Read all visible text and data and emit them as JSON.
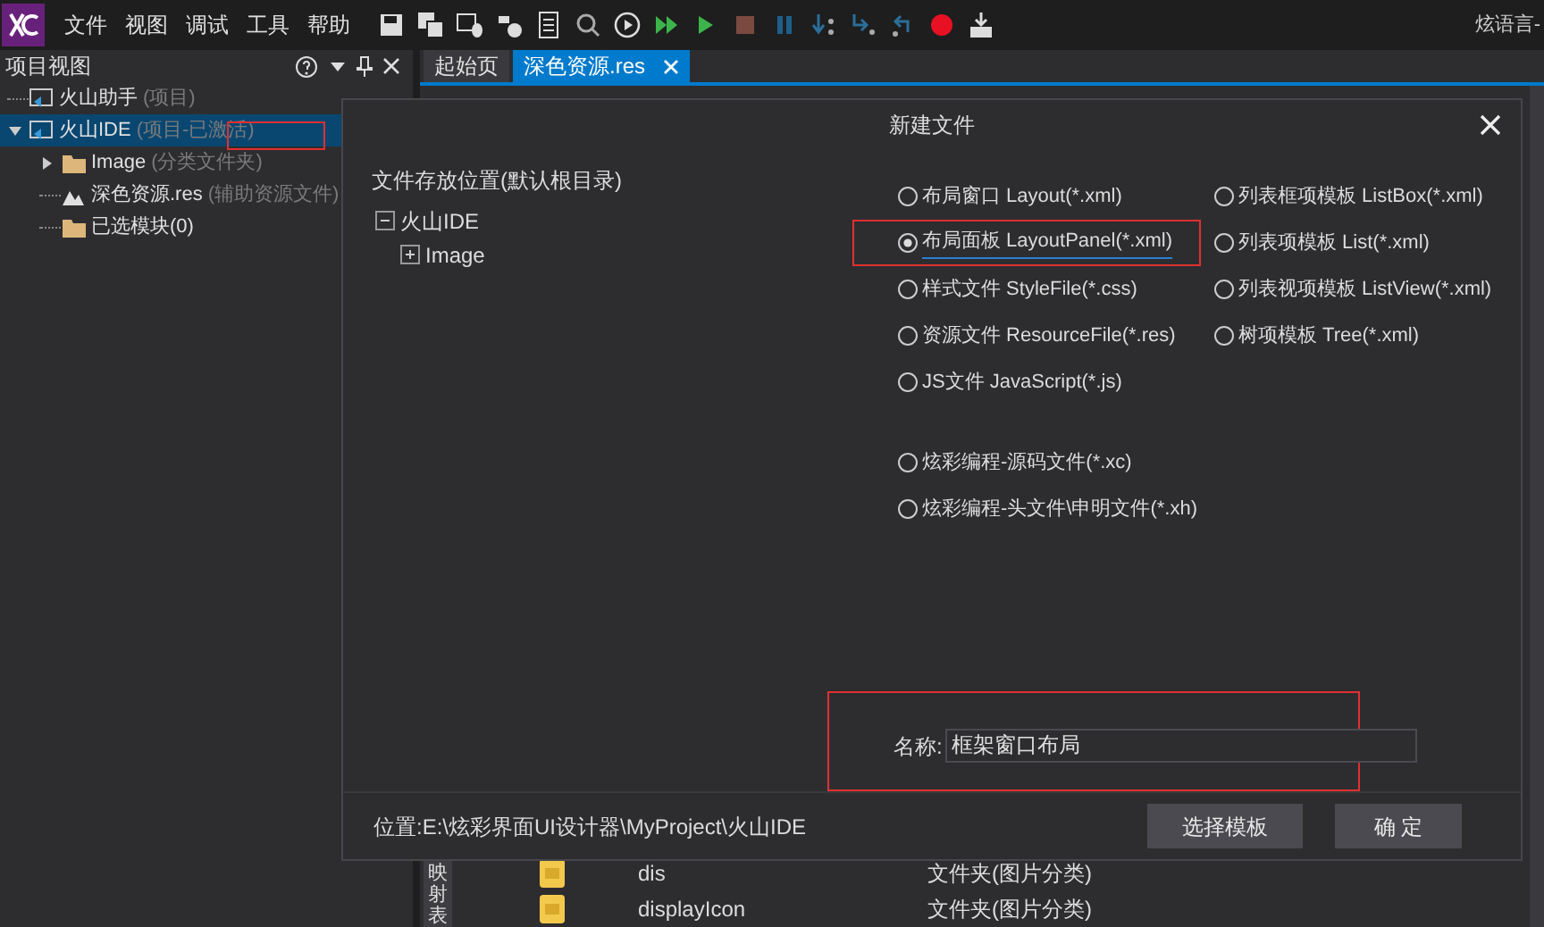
{
  "menu": [
    "文件",
    "视图",
    "调试",
    "工具",
    "帮助"
  ],
  "title_fragment": "炫语言-",
  "project_panel": {
    "title": "项目视图",
    "tree": [
      {
        "label": "火山助手",
        "note": "(项目)",
        "kind": "project",
        "selected": false
      },
      {
        "label": "火山IDE",
        "note": "(项目-已激活)",
        "kind": "project",
        "selected": true,
        "expanded": true,
        "children": [
          {
            "label": "Image",
            "note": "(分类文件夹)",
            "kind": "folder",
            "selected": false,
            "expanded": false
          },
          {
            "label": "深色资源.res",
            "note": "(辅助资源文件)",
            "kind": "resource",
            "selected": false
          },
          {
            "label": "已选模块(0)",
            "kind": "folder",
            "selected": false
          }
        ]
      }
    ]
  },
  "tabs": [
    {
      "label": "起始页",
      "selected": false
    },
    {
      "label": "深色资源.res",
      "selected": true
    }
  ],
  "background_list": {
    "side_label": "映射表",
    "rows": [
      {
        "name": "dis",
        "type": "文件夹(图片分类)"
      },
      {
        "name": "displayIcon",
        "type": "文件夹(图片分类)"
      }
    ]
  },
  "dialog": {
    "title": "新建文件",
    "folder_label": "文件存放位置(默认根目录)",
    "folders": [
      {
        "label": "火山IDE",
        "expanded": true,
        "children": [
          {
            "label": "Image",
            "expanded": false
          }
        ]
      }
    ],
    "left_column": [
      {
        "label": "布局窗口 Layout(*.xml)",
        "selected": false
      },
      {
        "label": "布局面板 LayoutPanel(*.xml)",
        "selected": true
      },
      {
        "label": "样式文件 StyleFile(*.css)",
        "selected": false
      },
      {
        "label": "资源文件 ResourceFile(*.res)",
        "selected": false
      },
      {
        "label": "JS文件 JavaScript(*.js)",
        "selected": false
      }
    ],
    "xc_options": [
      {
        "label": "炫彩编程-源码文件(*.xc)",
        "selected": false
      },
      {
        "label": "炫彩编程-头文件\\申明文件(*.xh)",
        "selected": false
      }
    ],
    "right_column": [
      {
        "label": "列表框项模板 ListBox(*.xml)",
        "selected": false
      },
      {
        "label": "列表项模板 List(*.xml)",
        "selected": false
      },
      {
        "label": "列表视项模板 ListView(*.xml)",
        "selected": false
      },
      {
        "label": "树项模板 Tree(*.xml)",
        "selected": false
      }
    ],
    "name_label": "名称:",
    "name_value": "框架窗口布局",
    "path": "位置:E:\\炫彩界面UI设计器\\MyProject\\火山IDE",
    "buttons": [
      "选择模板",
      "确 定"
    ]
  }
}
